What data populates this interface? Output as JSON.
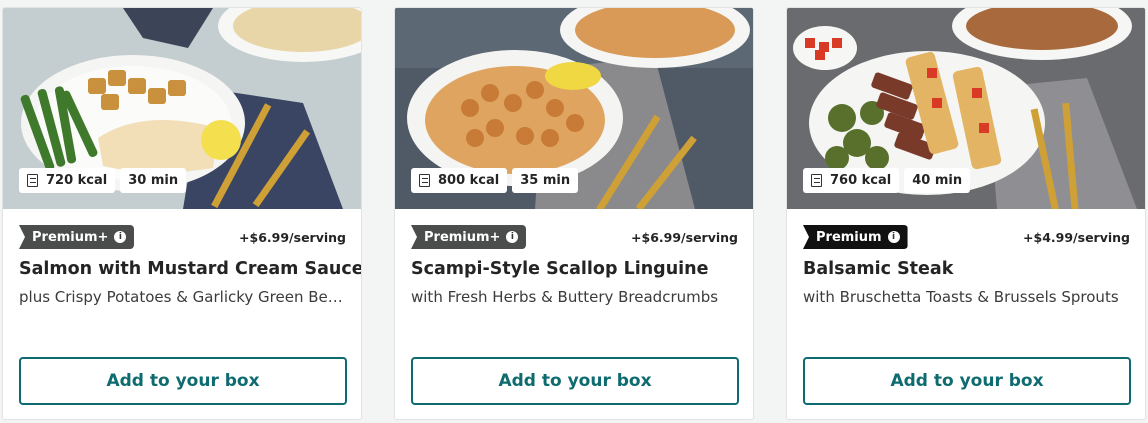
{
  "cards": [
    {
      "kcal": "720 kcal",
      "time": "30 min",
      "tag": "Premium+",
      "price": "+$6.99/serving",
      "title": "Salmon with Mustard Cream Sauce",
      "subtitle": "plus Crispy Potatoes & Garlicky Green Beans",
      "button": "Add to your box"
    },
    {
      "kcal": "800 kcal",
      "time": "35 min",
      "tag": "Premium+",
      "price": "+$6.99/serving",
      "title": "Scampi-Style Scallop Linguine",
      "subtitle": "with Fresh Herbs & Buttery Breadcrumbs",
      "button": "Add to your box"
    },
    {
      "kcal": "760 kcal",
      "time": "40 min",
      "tag": "Premium",
      "price": "+$4.99/serving",
      "title": "Balsamic Steak",
      "subtitle": "with Bruschetta Toasts & Brussels Sprouts",
      "button": "Add to your box"
    }
  ],
  "colors": {
    "accent": "#0e6b6f",
    "tag_premium_plus": "#4b4d4c",
    "tag_premium": "#111111"
  }
}
